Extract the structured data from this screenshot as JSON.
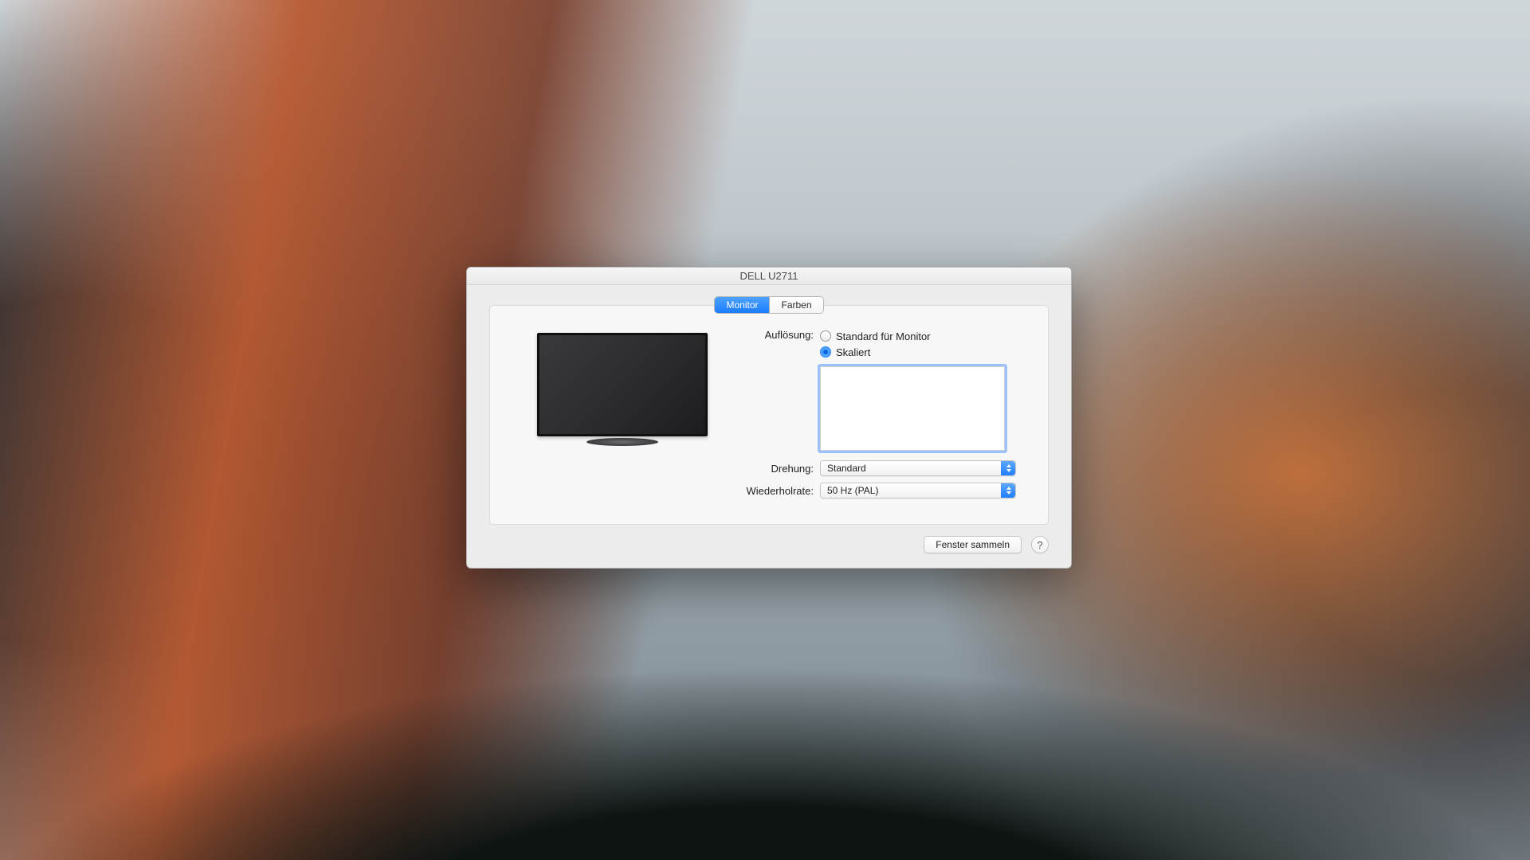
{
  "window": {
    "title": "DELL U2711"
  },
  "tabs": {
    "monitor": "Monitor",
    "colors": "Farben"
  },
  "labels": {
    "resolution": "Auflösung:",
    "rotation": "Drehung:",
    "refresh": "Wiederholrate:"
  },
  "resolution": {
    "option_default": "Standard für Monitor",
    "option_scaled": "Skaliert",
    "selected": "scaled"
  },
  "rotation": {
    "value": "Standard"
  },
  "refresh": {
    "value": "50 Hz (PAL)"
  },
  "footer": {
    "gather": "Fenster sammeln",
    "help": "?"
  }
}
